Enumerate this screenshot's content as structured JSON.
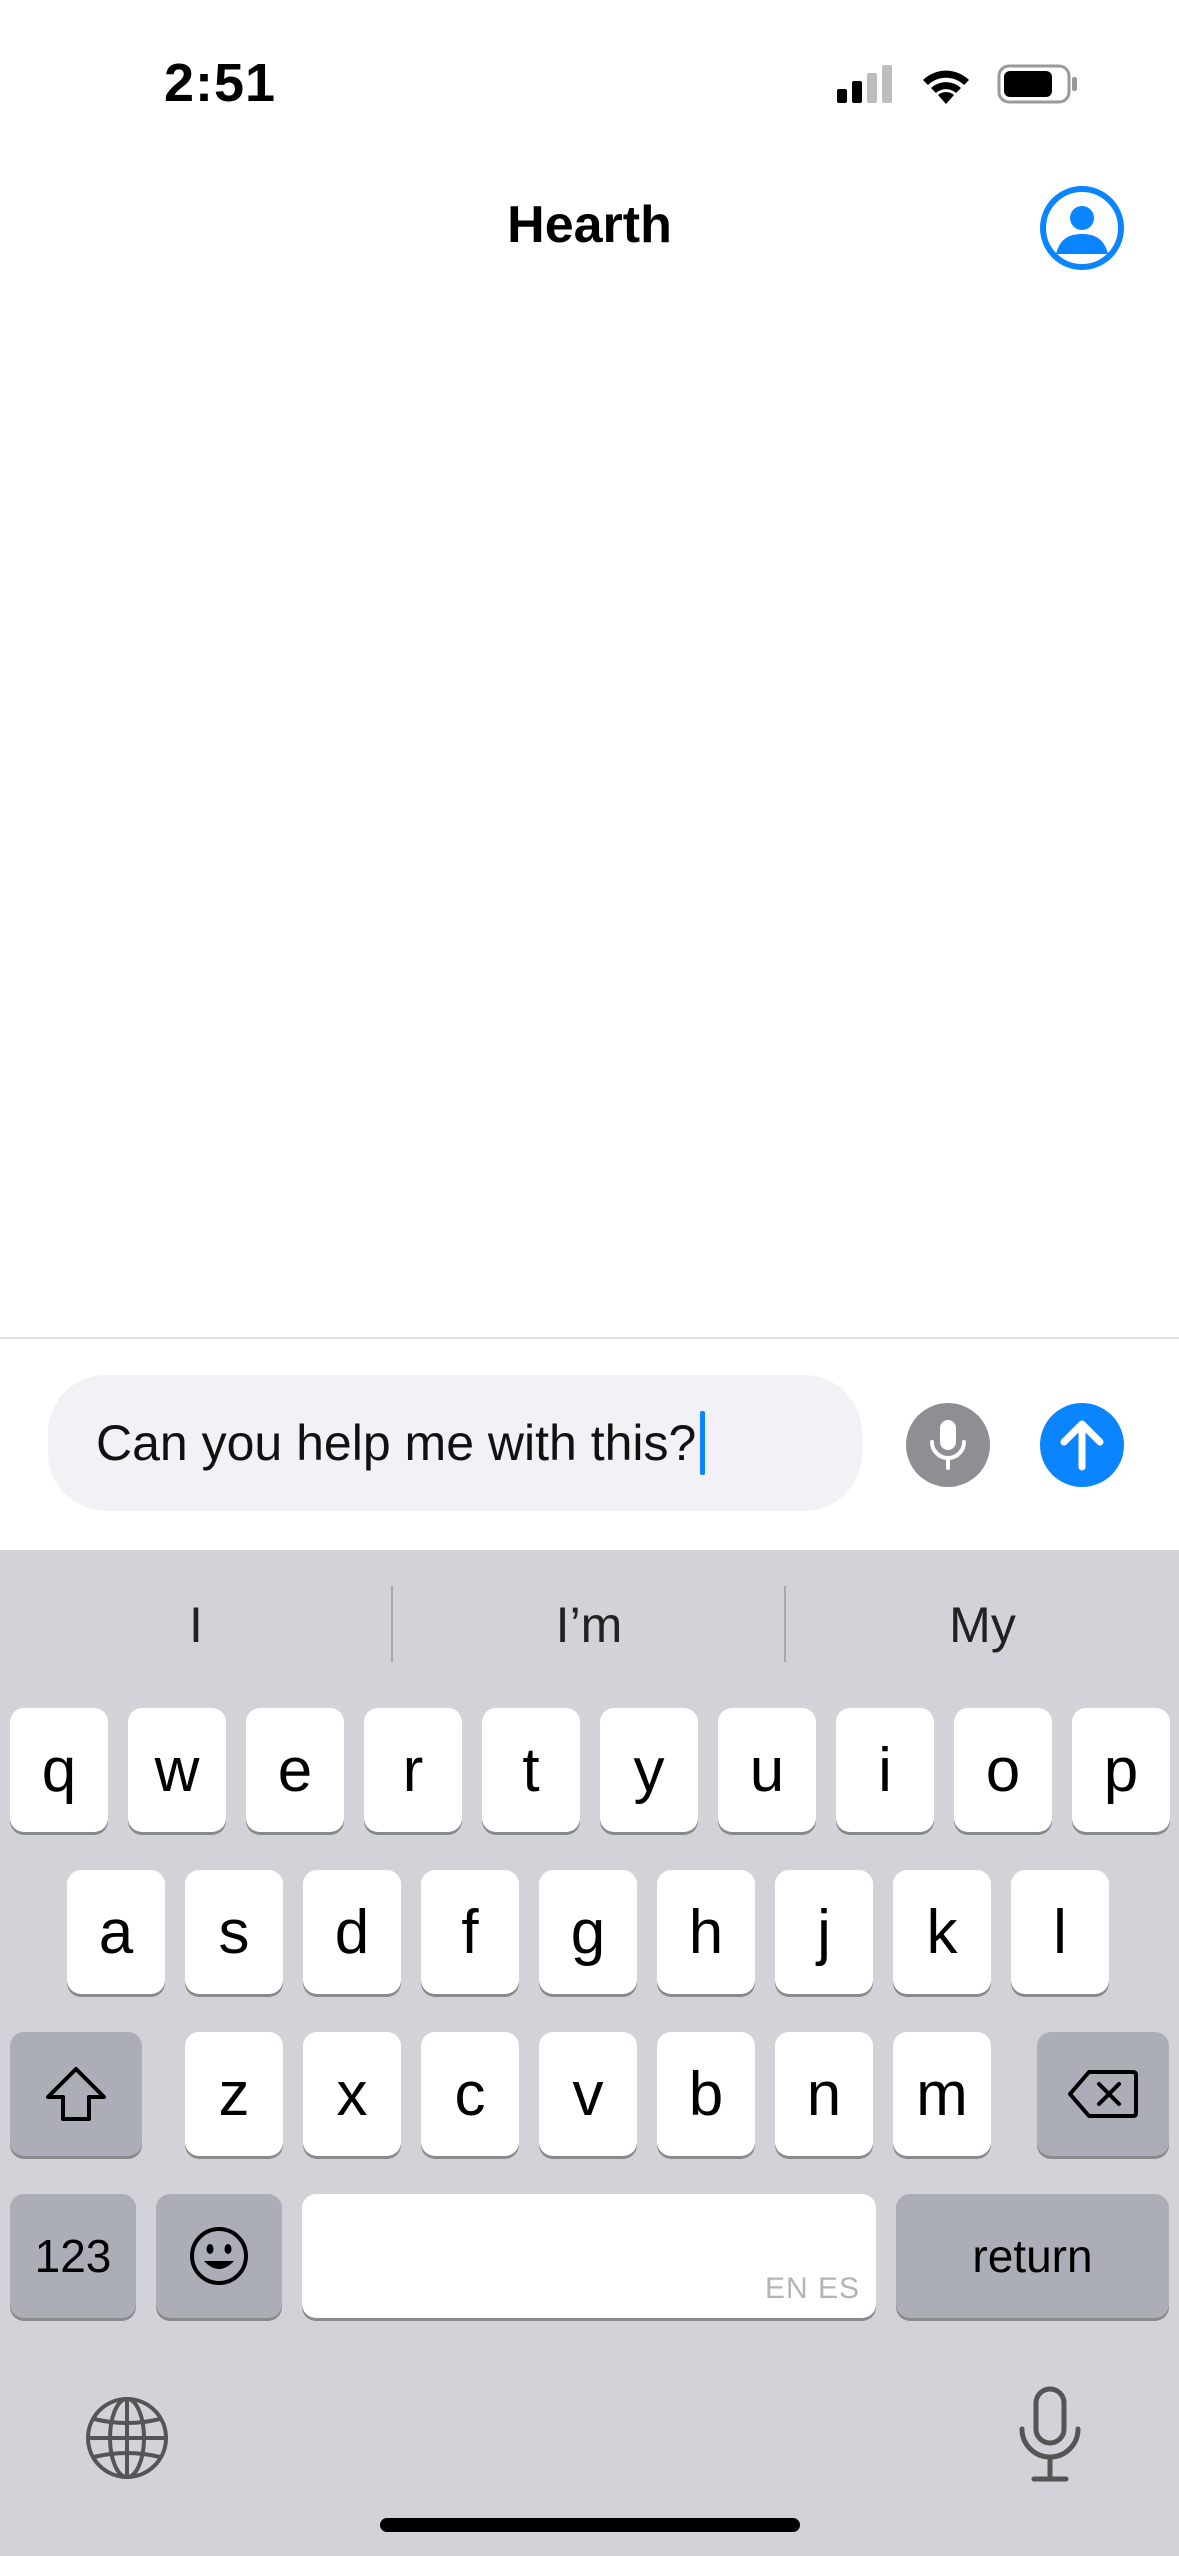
{
  "status_bar": {
    "time": "2:51"
  },
  "nav": {
    "title": "Hearth"
  },
  "composer": {
    "text": "Can you help me with this?"
  },
  "keyboard": {
    "suggestions": [
      "I",
      "I’m",
      "My"
    ],
    "row1": [
      "q",
      "w",
      "e",
      "r",
      "t",
      "y",
      "u",
      "i",
      "o",
      "p"
    ],
    "row2": [
      "a",
      "s",
      "d",
      "f",
      "g",
      "h",
      "j",
      "k",
      "l"
    ],
    "row3": [
      "z",
      "x",
      "c",
      "v",
      "b",
      "n",
      "m"
    ],
    "numbers_label": "123",
    "return_label": "return",
    "space_lang": "EN ES"
  },
  "colors": {
    "accent": "#0A84FF",
    "keyboard_bg": "#D1D3D9",
    "key_dark": "#ABAEB7",
    "input_bg": "#F1F1F6"
  },
  "icons": [
    "signal-icon",
    "wifi-icon",
    "battery-icon",
    "profile-icon",
    "mic-icon",
    "send-arrow-icon",
    "shift-icon",
    "delete-icon",
    "emoji-icon",
    "globe-icon",
    "dictation-mic-icon"
  ]
}
